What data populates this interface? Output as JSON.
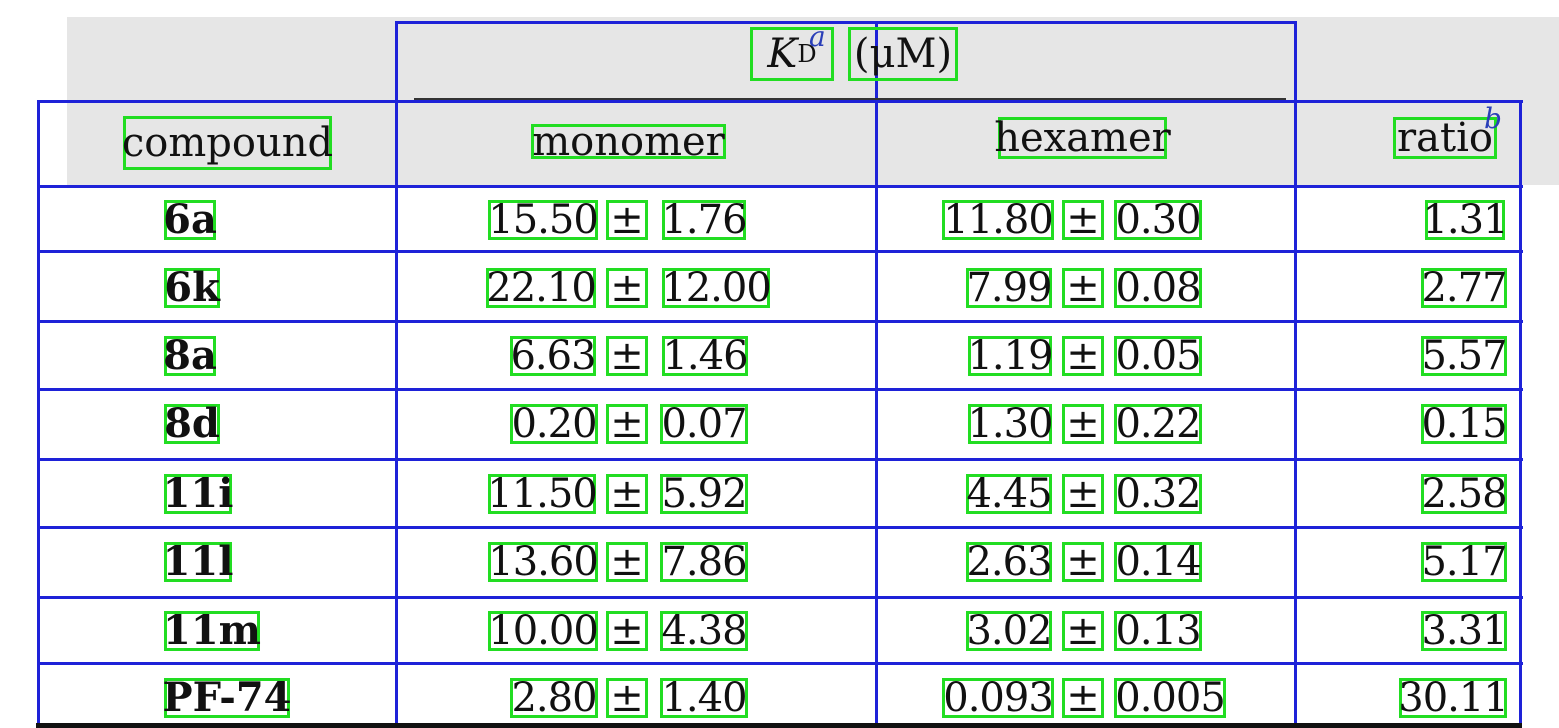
{
  "header": {
    "group_label_k": "K",
    "group_label_sub": "D",
    "group_label_unit": "(μM)",
    "footnote_a": "a",
    "footnote_b": "b",
    "columns": [
      "compound",
      "monomer",
      "hexamer",
      "ratio"
    ]
  },
  "rows": [
    {
      "compound": "6a",
      "mono_val": "15.50",
      "mono_err": "1.76",
      "hex_val": "11.80",
      "hex_err": "0.30",
      "ratio": "1.31"
    },
    {
      "compound": "6k",
      "mono_val": "22.10",
      "mono_err": "12.00",
      "hex_val": "7.99",
      "hex_err": "0.08",
      "ratio": "2.77"
    },
    {
      "compound": "8a",
      "mono_val": "6.63",
      "mono_err": "1.46",
      "hex_val": "1.19",
      "hex_err": "0.05",
      "ratio": "5.57"
    },
    {
      "compound": "8d",
      "mono_val": "0.20",
      "mono_err": "0.07",
      "hex_val": "1.30",
      "hex_err": "0.22",
      "ratio": "0.15"
    },
    {
      "compound": "11i",
      "mono_val": "11.50",
      "mono_err": "5.92",
      "hex_val": "4.45",
      "hex_err": "0.32",
      "ratio": "2.58"
    },
    {
      "compound": "11l",
      "mono_val": "13.60",
      "mono_err": "7.86",
      "hex_val": "2.63",
      "hex_err": "0.14",
      "ratio": "5.17"
    },
    {
      "compound": "11m",
      "mono_val": "10.00",
      "mono_err": "4.38",
      "hex_val": "3.02",
      "hex_err": "0.13",
      "ratio": "3.31"
    },
    {
      "compound": "PF-74",
      "mono_val": "2.80",
      "mono_err": "1.40",
      "hex_val": "0.093",
      "hex_err": "0.005",
      "ratio": "30.11"
    }
  ],
  "plus_minus": "±"
}
